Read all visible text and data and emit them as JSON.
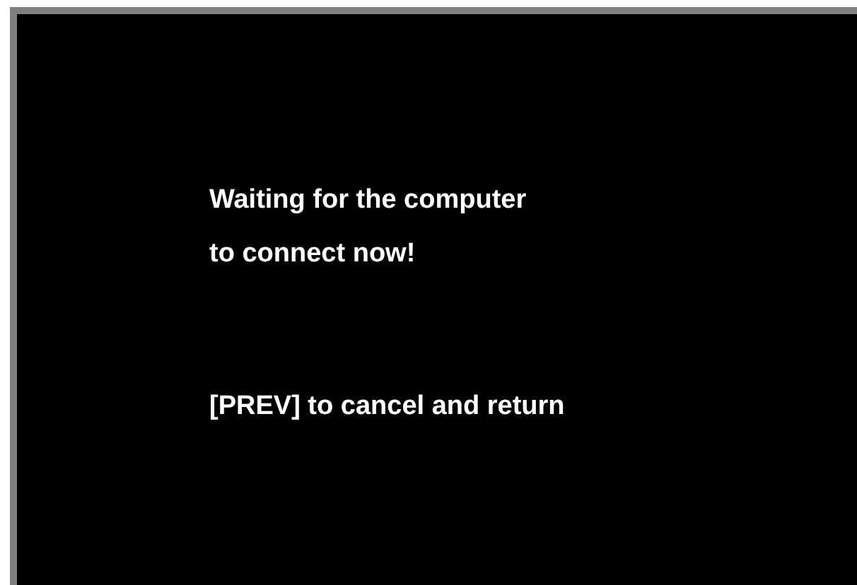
{
  "message": {
    "lines": [
      "Waiting for the computer",
      "to connect now!"
    ]
  },
  "hint": "[PREV] to cancel and return"
}
